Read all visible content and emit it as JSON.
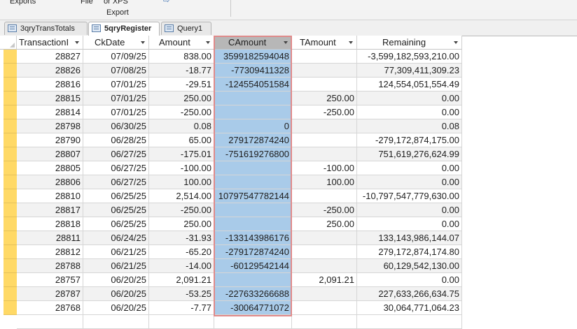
{
  "ribbon": {
    "exports_label": "Exports",
    "file_label": "File",
    "xps_label": "or XPS",
    "export_group_label": "Export"
  },
  "tabs": [
    {
      "label": "3qryTransTotals",
      "active": false
    },
    {
      "label": "5qryRegister",
      "active": true
    },
    {
      "label": "Query1",
      "active": false
    }
  ],
  "columns": [
    {
      "label": "TransactionI",
      "sorted": true
    },
    {
      "label": "CkDate",
      "sorted": true
    },
    {
      "label": "Amount",
      "sorted": true
    },
    {
      "label": "CAmount",
      "sorted": true,
      "selected": true
    },
    {
      "label": "TAmount",
      "sorted": true
    },
    {
      "label": "Remaining",
      "sorted": true
    }
  ],
  "rows": [
    {
      "id": "28827",
      "date": "07/09/25",
      "amount": "838.00",
      "camount": "3599182594048",
      "tamount": "",
      "remaining": "-3,599,182,593,210.00"
    },
    {
      "id": "28826",
      "date": "07/08/25",
      "amount": "-18.77",
      "camount": "-77309411328",
      "tamount": "",
      "remaining": "77,309,411,309.23"
    },
    {
      "id": "28816",
      "date": "07/01/25",
      "amount": "-29.51",
      "camount": "-124554051584",
      "tamount": "",
      "remaining": "124,554,051,554.49"
    },
    {
      "id": "28815",
      "date": "07/01/25",
      "amount": "250.00",
      "camount": "",
      "tamount": "250.00",
      "remaining": "0.00"
    },
    {
      "id": "28814",
      "date": "07/01/25",
      "amount": "-250.00",
      "camount": "",
      "tamount": "-250.00",
      "remaining": "0.00"
    },
    {
      "id": "28798",
      "date": "06/30/25",
      "amount": "0.08",
      "camount": "0",
      "tamount": "",
      "remaining": "0.08"
    },
    {
      "id": "28790",
      "date": "06/28/25",
      "amount": "65.00",
      "camount": "279172874240",
      "tamount": "",
      "remaining": "-279,172,874,175.00"
    },
    {
      "id": "28807",
      "date": "06/27/25",
      "amount": "-175.01",
      "camount": "-751619276800",
      "tamount": "",
      "remaining": "751,619,276,624.99"
    },
    {
      "id": "28805",
      "date": "06/27/25",
      "amount": "-100.00",
      "camount": "",
      "tamount": "-100.00",
      "remaining": "0.00"
    },
    {
      "id": "28806",
      "date": "06/27/25",
      "amount": "100.00",
      "camount": "",
      "tamount": "100.00",
      "remaining": "0.00"
    },
    {
      "id": "28810",
      "date": "06/25/25",
      "amount": "2,514.00",
      "camount": "10797547782144",
      "tamount": "",
      "remaining": "-10,797,547,779,630.00"
    },
    {
      "id": "28817",
      "date": "06/25/25",
      "amount": "-250.00",
      "camount": "",
      "tamount": "-250.00",
      "remaining": "0.00"
    },
    {
      "id": "28818",
      "date": "06/25/25",
      "amount": "250.00",
      "camount": "",
      "tamount": "250.00",
      "remaining": "0.00"
    },
    {
      "id": "28811",
      "date": "06/24/25",
      "amount": "-31.93",
      "camount": "-133143986176",
      "tamount": "",
      "remaining": "133,143,986,144.07"
    },
    {
      "id": "28812",
      "date": "06/21/25",
      "amount": "-65.20",
      "camount": "-279172874240",
      "tamount": "",
      "remaining": "279,172,874,174.80"
    },
    {
      "id": "28788",
      "date": "06/21/25",
      "amount": "-14.00",
      "camount": "-60129542144",
      "tamount": "",
      "remaining": "60,129,542,130.00"
    },
    {
      "id": "28757",
      "date": "06/20/25",
      "amount": "2,091.21",
      "camount": "",
      "tamount": "2,091.21",
      "remaining": "0.00"
    },
    {
      "id": "28787",
      "date": "06/20/25",
      "amount": "-53.25",
      "camount": "-227633266688",
      "tamount": "",
      "remaining": "227,633,266,634.75"
    },
    {
      "id": "28768",
      "date": "06/20/25",
      "amount": "-7.77",
      "camount": "-30064771072",
      "tamount": "",
      "remaining": "30,064,771,064.23"
    }
  ],
  "colors": {
    "row_selector": "#ffd966",
    "selected_column": "#a9cbe9",
    "selected_border": "#e08a8a",
    "alt_row": "#f2f2f2"
  }
}
